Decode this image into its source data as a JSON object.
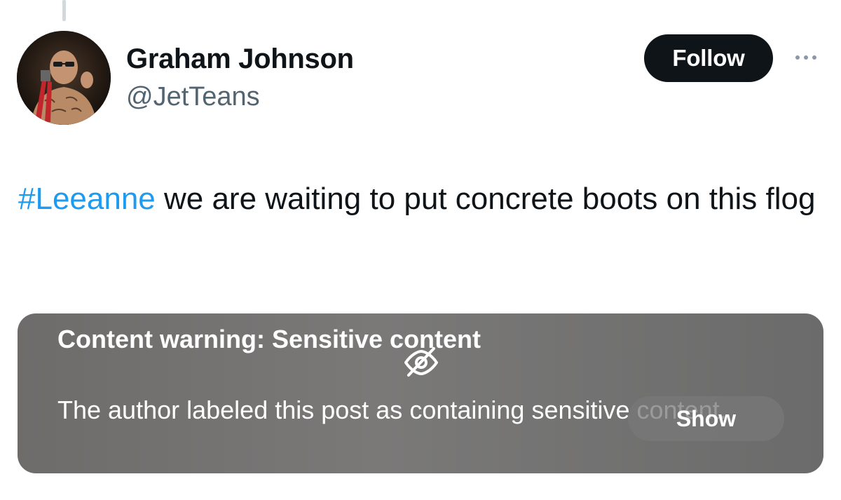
{
  "tweet": {
    "author": {
      "display_name": "Graham Johnson",
      "handle": "@JetTeans"
    },
    "follow_label": "Follow",
    "text": {
      "hashtag": "#Leeanne",
      "body": " we are waiting to put concrete boots on this flog"
    },
    "media_warning": {
      "title": "Content warning: Sensitive content",
      "description": "The author labeled this post as containing sensitive content.",
      "show_label": "Show"
    }
  },
  "icons": {
    "more": "more-horizontal-icon",
    "warning": "eye-slash-icon"
  },
  "colors": {
    "follow_bg": "#0f1419",
    "hashtag": "#1d9bf0",
    "handle": "#536471",
    "warning_card": "#737271"
  }
}
